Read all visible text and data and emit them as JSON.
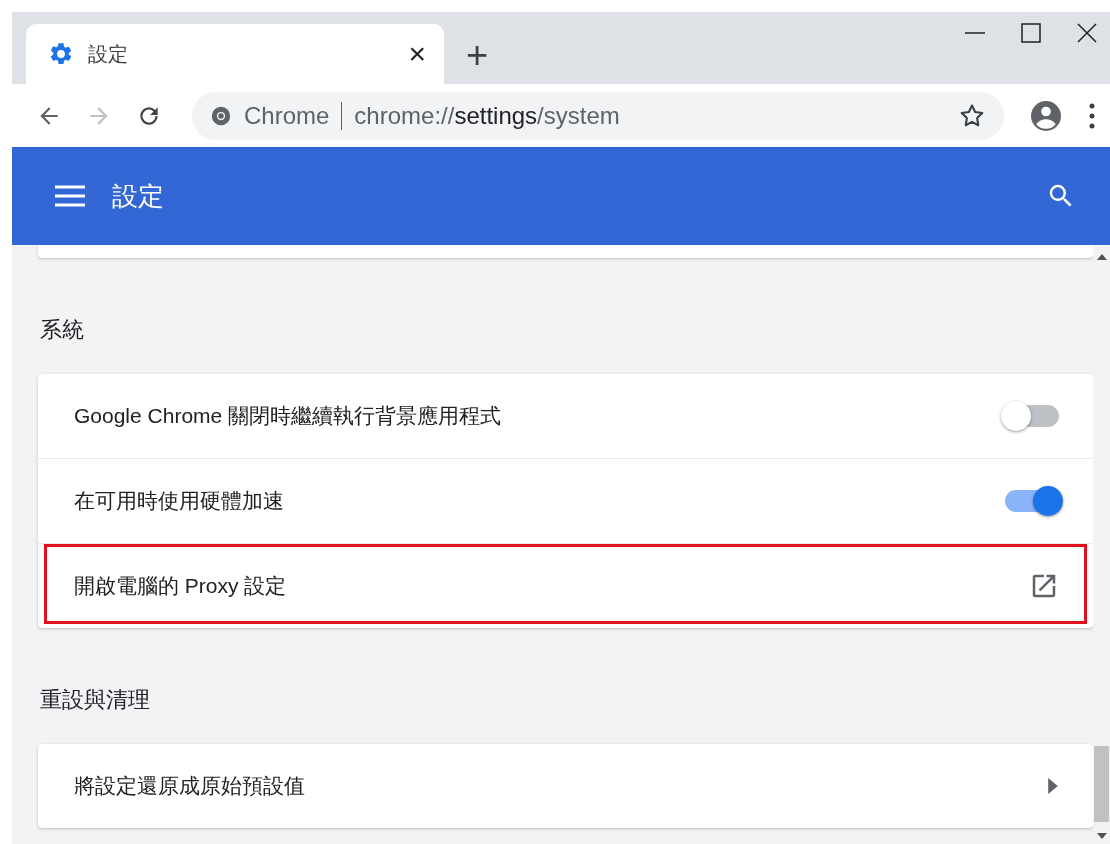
{
  "tab": {
    "title": "設定",
    "close": "×",
    "new_tab": "+"
  },
  "address_bar": {
    "site": "Chrome",
    "scheme": "chrome://",
    "host": "settings",
    "path": "/system"
  },
  "header": {
    "title": "設定"
  },
  "sections": [
    {
      "title": "系統",
      "rows": [
        {
          "kind": "toggle",
          "label": "Google Chrome 關閉時繼續執行背景應用程式",
          "on": false,
          "highlighted": false
        },
        {
          "kind": "toggle",
          "label": "在可用時使用硬體加速",
          "on": true,
          "highlighted": false
        },
        {
          "kind": "external",
          "label": "開啟電腦的 Proxy 設定",
          "highlighted": true
        }
      ]
    },
    {
      "title": "重設與清理",
      "rows": [
        {
          "kind": "arrow",
          "label": "將設定還原成原始預設值",
          "highlighted": false
        }
      ]
    }
  ]
}
